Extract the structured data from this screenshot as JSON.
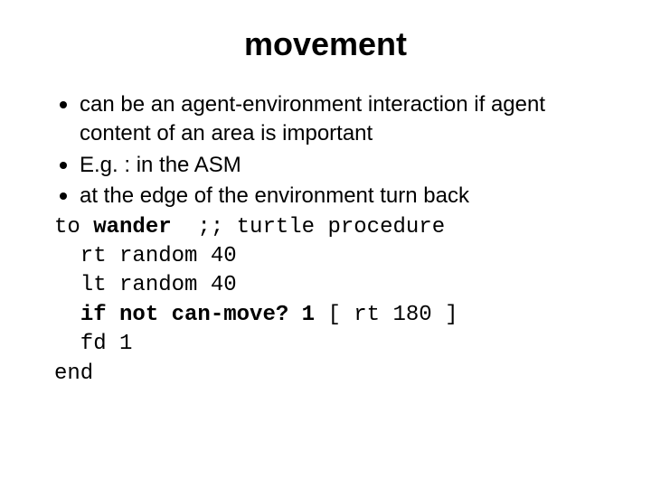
{
  "title": "movement",
  "bullets": [
    "can be an agent-environment interaction if agent content of an area is important",
    "E.g. : in the ASM",
    "at the edge of the environment turn back"
  ],
  "code": {
    "header_prefix": "to ",
    "header_name": "wander",
    "header_comment": "  ;; turtle procedure",
    "lines": [
      "  rt random 40",
      "  lt random 40"
    ],
    "ifline_prefix": "  ",
    "ifline_keyword": "if not can-move? 1",
    "ifline_suffix": " [ rt 180 ]",
    "fd_line": "  fd 1",
    "end": "end"
  }
}
